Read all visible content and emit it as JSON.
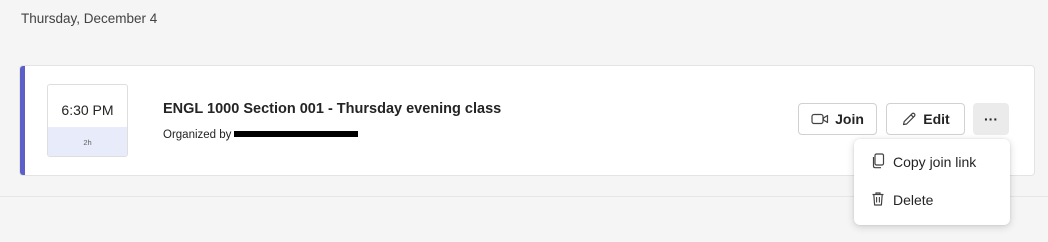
{
  "date_heading": "Thursday, December 4",
  "meeting": {
    "time": "6:30 PM",
    "duration": "2h",
    "title": "ENGL 1000 Section 001 - Thursday evening class",
    "organizer_label": "Organized by",
    "accent_color": "#5b5fc7"
  },
  "actions": {
    "join_label": "Join",
    "join_icon": "video-camera-icon",
    "edit_label": "Edit",
    "edit_icon": "pencil-icon",
    "more_label": "···"
  },
  "context_menu": {
    "items": [
      {
        "label": "Copy join link",
        "icon": "copy-icon"
      },
      {
        "label": "Delete",
        "icon": "trash-icon"
      }
    ]
  }
}
